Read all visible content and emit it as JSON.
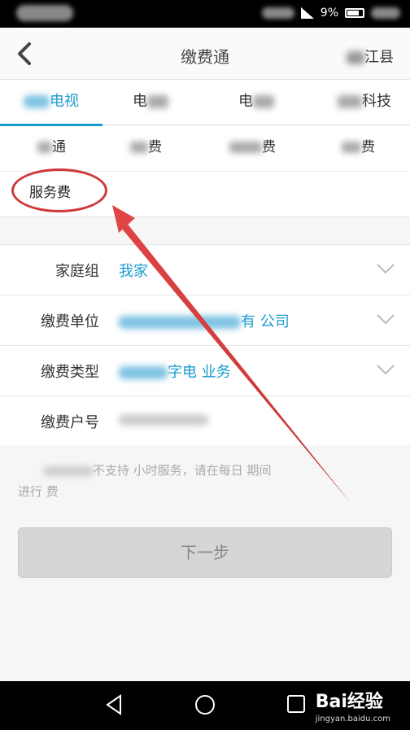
{
  "status_bar": {
    "battery": "9%"
  },
  "header": {
    "title": "缴费通",
    "region": "江县"
  },
  "tabs": [
    {
      "label": "电视",
      "active": true
    },
    {
      "label": "电"
    },
    {
      "label": "电"
    },
    {
      "label": "科技"
    }
  ],
  "subtypes": [
    {
      "label": "通"
    },
    {
      "label": "费"
    },
    {
      "label": "费"
    },
    {
      "label": "费"
    },
    {
      "label": "服务费",
      "annotated": true
    }
  ],
  "form": {
    "rows": [
      {
        "label": "家庭组",
        "value": "我家",
        "dropdown": true
      },
      {
        "label": "缴费单位",
        "value": "有 公司",
        "dropdown": true
      },
      {
        "label": "缴费类型",
        "value": "字电 业务",
        "dropdown": true
      },
      {
        "label": "缴费户号",
        "value": "",
        "dropdown": false
      }
    ]
  },
  "notice": {
    "line1": "不支持 小时服务，请在每日 期间",
    "line2": "进行 费"
  },
  "next_button": {
    "label": "下一步"
  },
  "colors": {
    "accent": "#1a9bd0",
    "annotation": "#d0393b"
  },
  "watermark": {
    "brand": "Bai经验",
    "url": "jingyan.baidu.com"
  }
}
